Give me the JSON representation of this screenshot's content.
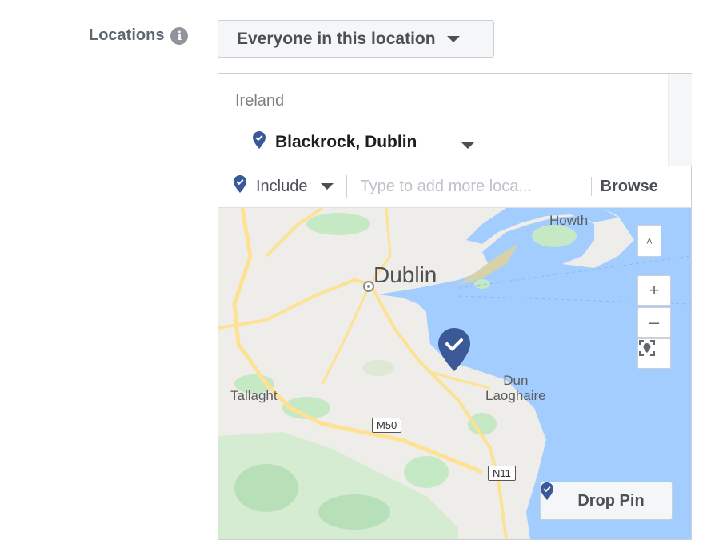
{
  "field": {
    "label": "Locations",
    "info_icon": "info-icon",
    "info_glyph": "i"
  },
  "audience_dropdown": {
    "selected": "Everyone in this location"
  },
  "selected_locations": {
    "country": "Ireland",
    "items": [
      {
        "name": "Blackrock, Dublin",
        "icon": "location-pin-icon"
      }
    ]
  },
  "search": {
    "mode": "Include",
    "placeholder": "Type to add more loca...",
    "value": "",
    "browse_label": "Browse"
  },
  "map": {
    "labels": {
      "city": "Dublin",
      "howth": "Howth",
      "tallaght": "Tallaght",
      "dun_line1": "Dun",
      "dun_line2": "Laoghaire"
    },
    "roads": {
      "m50": "M50",
      "n11": "N11"
    },
    "controls": {
      "up": "˄",
      "zoom_in": "+",
      "zoom_out": "–"
    },
    "drop_pin_label": "Drop Pin"
  },
  "colors": {
    "pin": "#3b5998",
    "water": "#a3ccff",
    "land": "#eeede9",
    "park": "#c5e8c5",
    "road": "#fde293"
  }
}
